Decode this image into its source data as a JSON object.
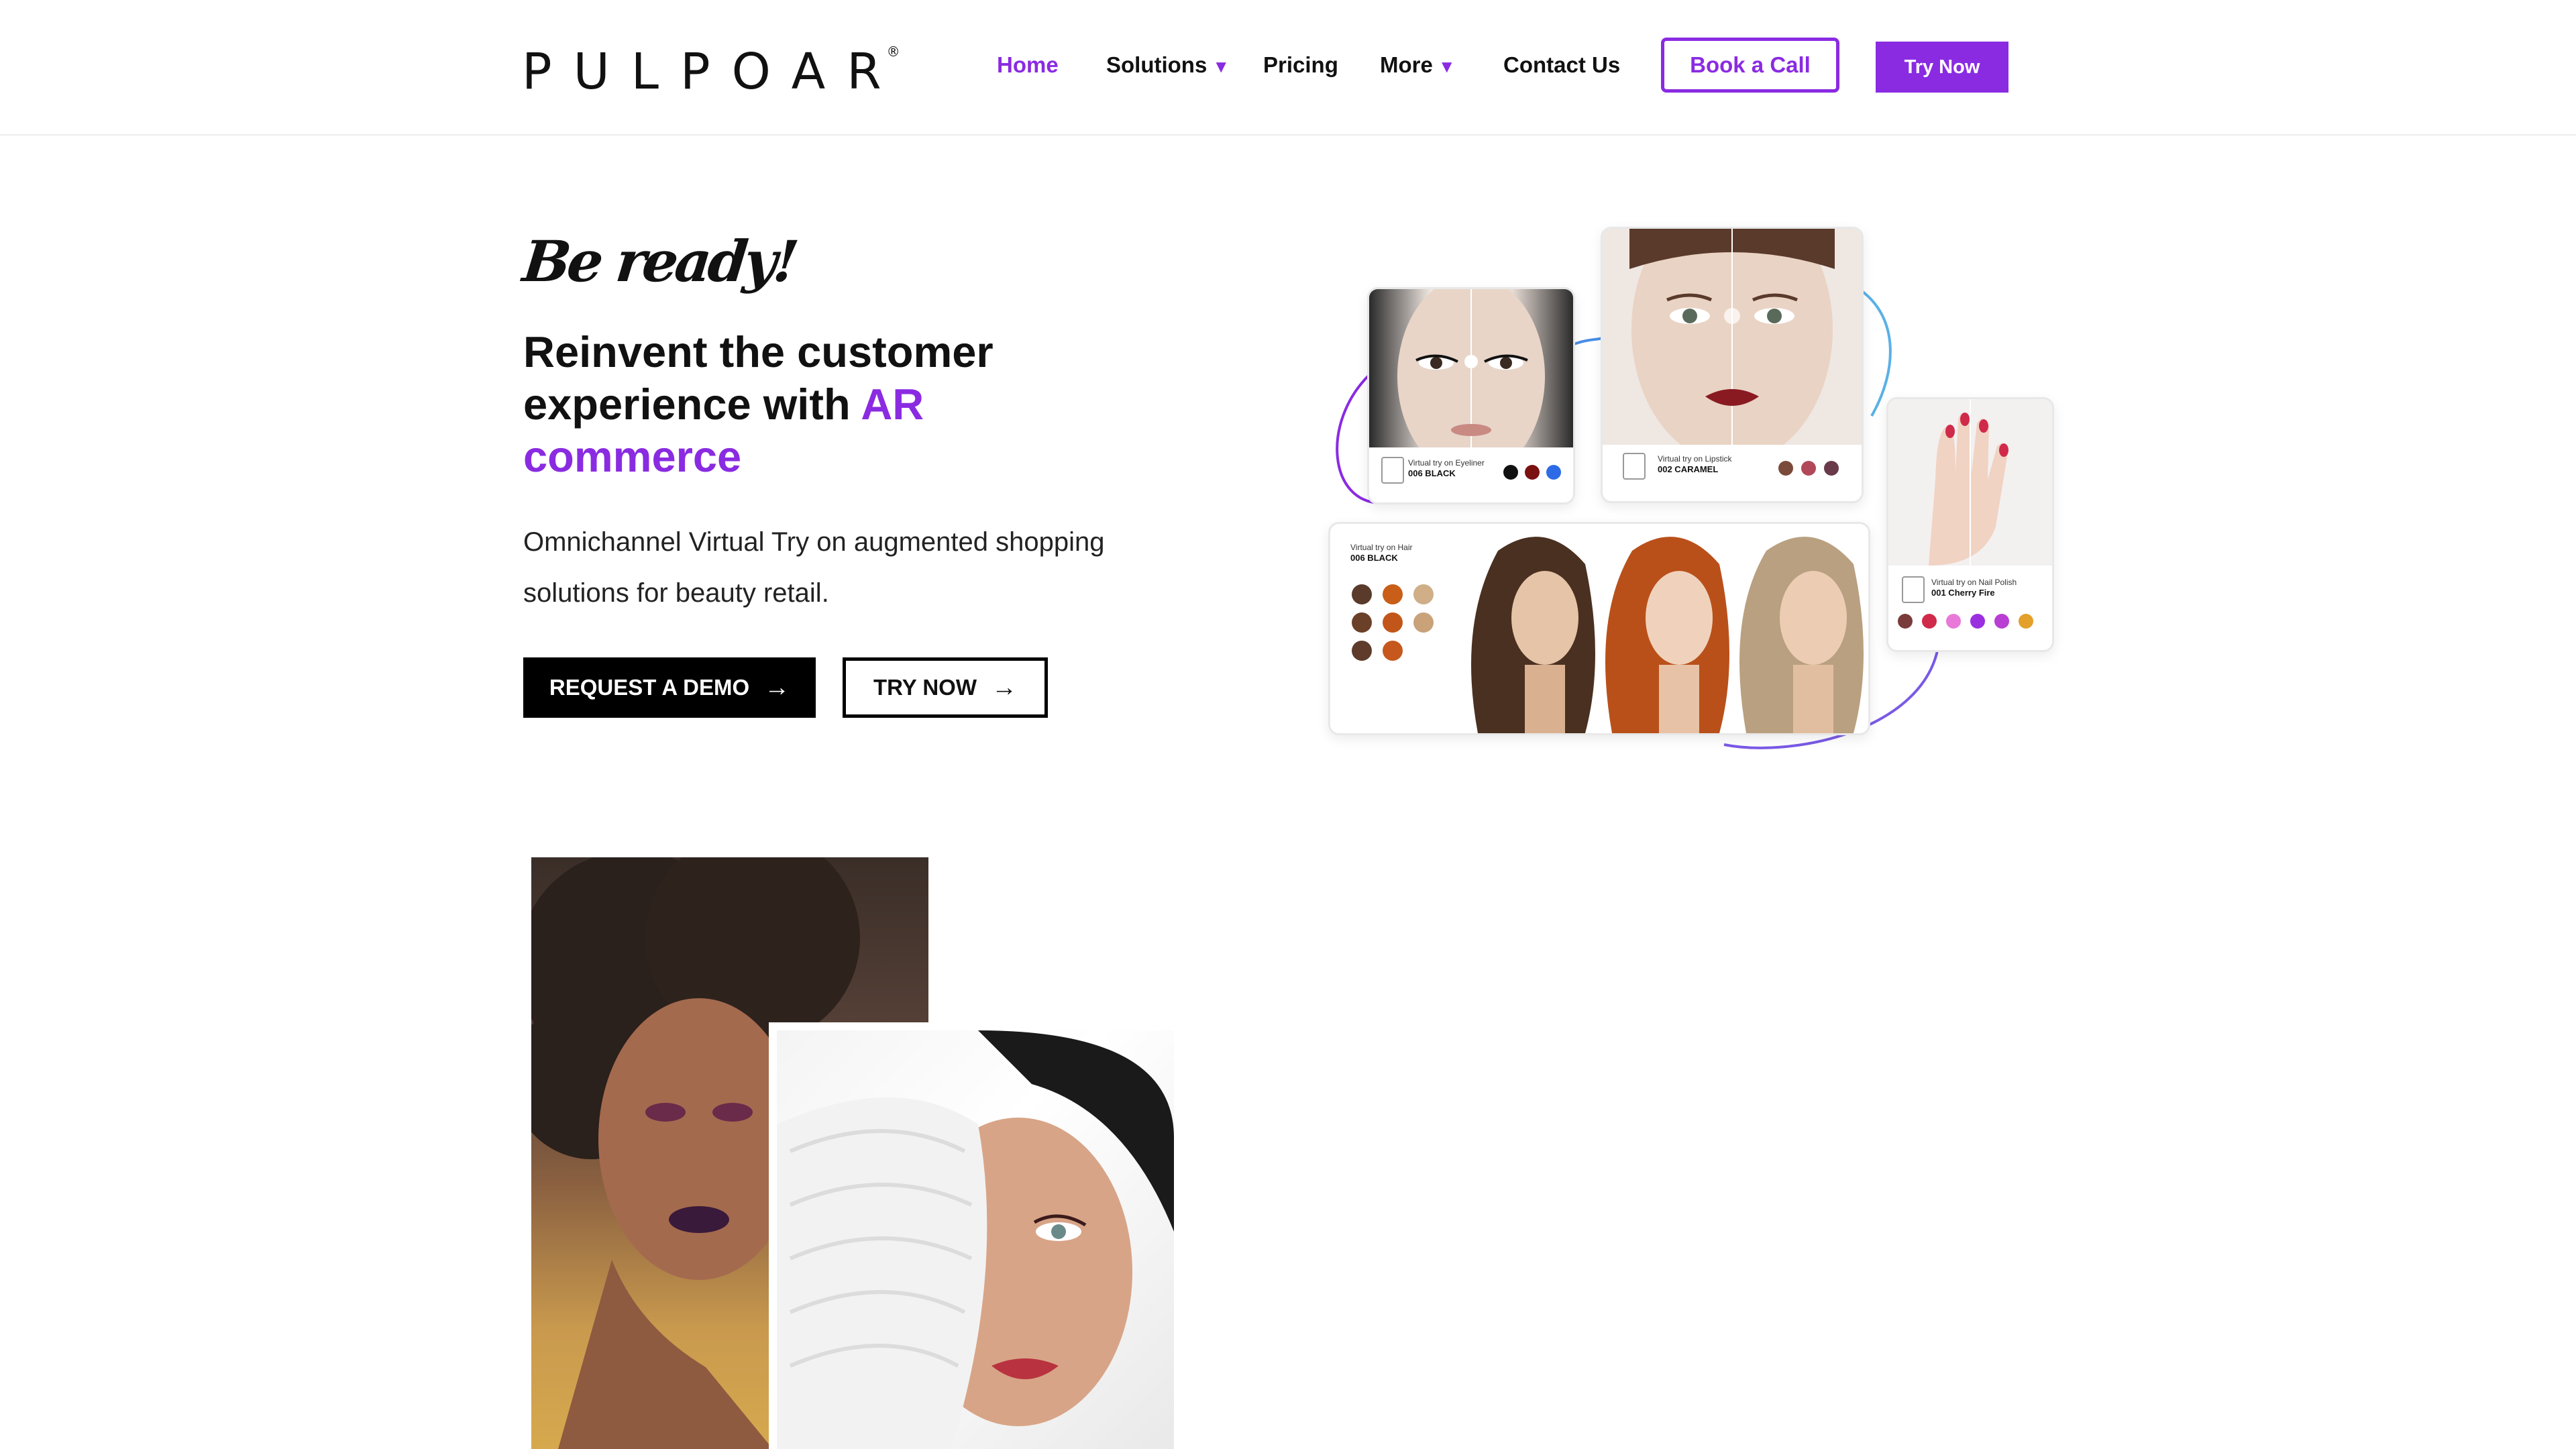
{
  "brand": {
    "logo_text": "PULPOAR",
    "registered_mark": "®",
    "accent_color": "#8a2be2"
  },
  "nav": {
    "items": [
      {
        "label": "Home",
        "active": true,
        "has_caret": false
      },
      {
        "label": "Solutions",
        "active": false,
        "has_caret": true
      },
      {
        "label": "Pricing",
        "active": false,
        "has_caret": false
      },
      {
        "label": "More",
        "active": false,
        "has_caret": true
      },
      {
        "label": "Contact Us",
        "active": false,
        "has_caret": false
      }
    ],
    "caret_symbol": "▼",
    "book_call_label": "Book a Call",
    "try_now_label": "Try Now"
  },
  "hero": {
    "tagline": "Be ready!",
    "headline_part1": "Reinvent the customer experience with ",
    "headline_accent": "AR commerce",
    "subtitle": "Omnichannel Virtual Try on augmented shopping solutions for beauty retail.",
    "cta_demo_label": "REQUEST A DEMO",
    "cta_try_label": "TRY NOW",
    "arrow_icon": "→"
  },
  "collage": {
    "eyeliner": {
      "label": "Virtual try on Eyeliner",
      "shade": "006 BLACK",
      "swatches": [
        "#111111",
        "#7a1010",
        "#2d6be6"
      ]
    },
    "lipstick": {
      "label": "Virtual try on Lipstick",
      "shade": "002 CARAMEL",
      "swatches": [
        "#7a4a3a",
        "#b0485a",
        "#6a3a4a"
      ]
    },
    "hair": {
      "label": "Virtual try on Hair",
      "shade": "006 BLACK",
      "swatches": [
        "#5a3a2a",
        "#c85e18",
        "#cfae88",
        "#6a4028",
        "#c2561a",
        "#c9a27a",
        "#5e3b2b",
        "#c6581d"
      ]
    },
    "nails": {
      "label": "Virtual try on Nail Polish",
      "shade": "001 Cherry Fire",
      "swatches": [
        "#7a3b3b",
        "#d02a4a",
        "#e879d8",
        "#9b2fe0",
        "#b93ed3",
        "#e3a02a"
      ]
    }
  }
}
